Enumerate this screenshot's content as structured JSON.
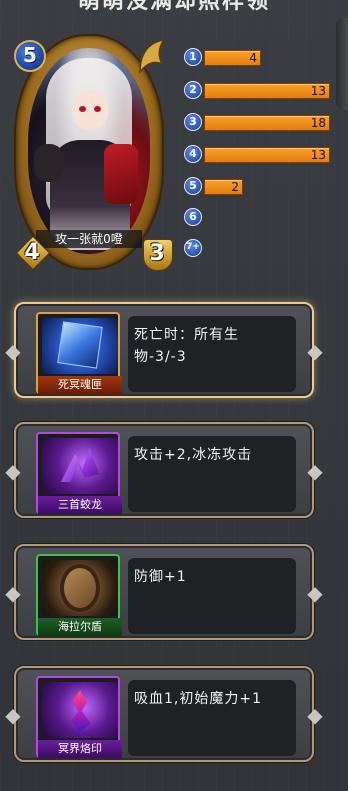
{
  "header": {
    "title": "萌萌没满却照样领"
  },
  "card": {
    "name": "攻一张就0噔",
    "cost": "5",
    "attack": "4",
    "health": "3"
  },
  "mana_curve": [
    {
      "cost": "1",
      "count": "4",
      "fill": 0.45
    },
    {
      "cost": "2",
      "count": "13",
      "fill": 1.0
    },
    {
      "cost": "3",
      "count": "18",
      "fill": 1.0
    },
    {
      "cost": "4",
      "count": "13",
      "fill": 1.0
    },
    {
      "cost": "5",
      "count": "2",
      "fill": 0.31
    },
    {
      "cost": "6",
      "count": "",
      "fill": 0
    },
    {
      "cost": "7+",
      "count": "",
      "fill": 0
    }
  ],
  "effects": [
    {
      "icon_name": "blue-soul-cube-icon",
      "icon_label": "死冥魂匣",
      "rarity": "gold",
      "description": "死亡时：所有生物-3/-3",
      "selected": true
    },
    {
      "icon_name": "purple-claw-icon",
      "icon_label": "三首蛟龙",
      "rarity": "purple",
      "description": "攻击+2,冰冻攻击",
      "selected": false
    },
    {
      "icon_name": "wooden-shield-icon",
      "icon_label": "海拉尔盾",
      "rarity": "green",
      "description": "防御+1",
      "selected": false
    },
    {
      "icon_name": "underworld-sigil-icon",
      "icon_label": "冥界烙印",
      "rarity": "purple",
      "description": "吸血1,初始魔力+1",
      "selected": false
    }
  ],
  "colors": {
    "background": "#34373c",
    "bar_orange": "#f28f1c",
    "frame_gold": "#d8a84a",
    "rarity_gold": "#e0a23a",
    "rarity_purple": "#b24ae0",
    "rarity_green": "#3fc24a"
  }
}
